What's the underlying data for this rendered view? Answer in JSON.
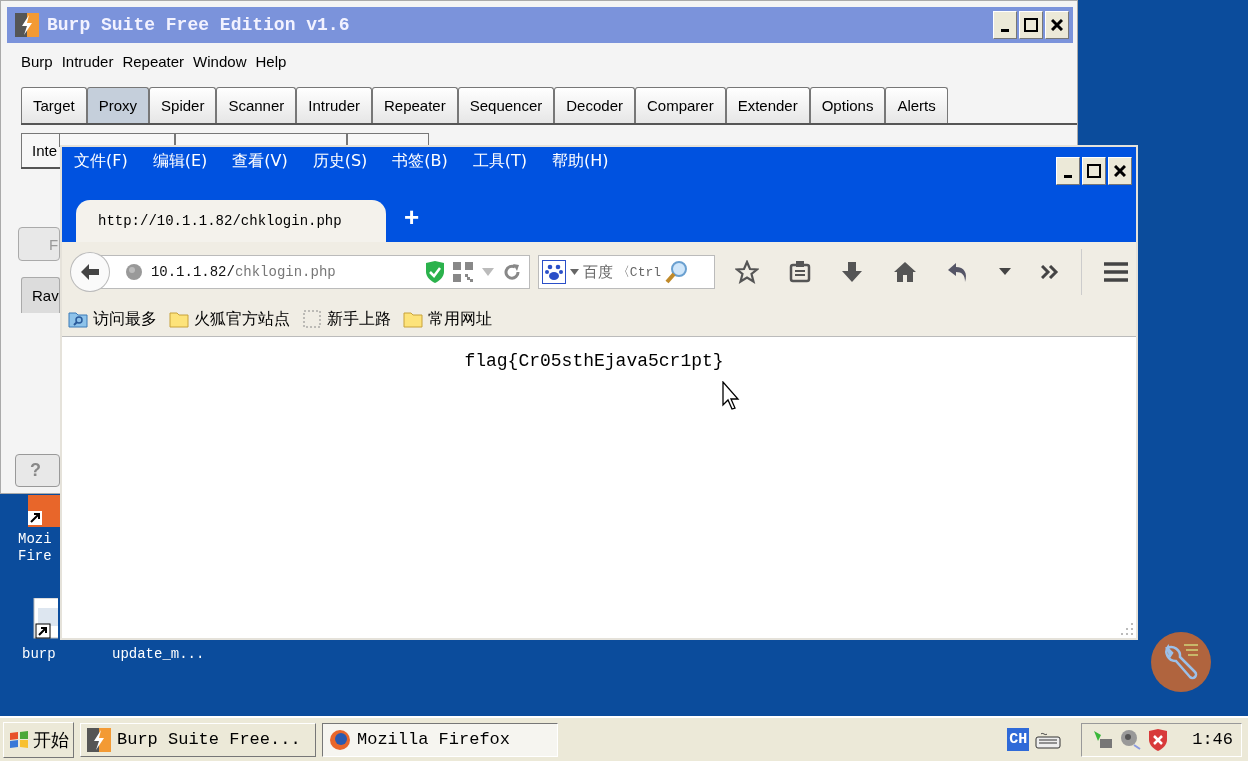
{
  "burp": {
    "title": "Burp Suite Free Edition v1.6",
    "menu": [
      "Burp",
      "Intruder",
      "Repeater",
      "Window",
      "Help"
    ],
    "tabs": [
      {
        "label": "Target",
        "selected": false
      },
      {
        "label": "Proxy",
        "selected": true
      },
      {
        "label": "Spider",
        "selected": false
      },
      {
        "label": "Scanner",
        "selected": false
      },
      {
        "label": "Intruder",
        "selected": false
      },
      {
        "label": "Repeater",
        "selected": false
      },
      {
        "label": "Sequencer",
        "selected": false
      },
      {
        "label": "Decoder",
        "selected": false
      },
      {
        "label": "Comparer",
        "selected": false
      },
      {
        "label": "Extender",
        "selected": false
      },
      {
        "label": "Options",
        "selected": false
      },
      {
        "label": "Alerts",
        "selected": false
      }
    ],
    "subtab": "Inte",
    "side_button": "F",
    "message_tab": "Rav",
    "help_button": "?"
  },
  "desktop_icons": [
    {
      "kind": "firefox",
      "lines": [
        "Mozi",
        "Fire"
      ]
    },
    {
      "kind": "shortcut",
      "lines": [
        "burp"
      ]
    },
    {
      "kind": "label-only",
      "lines": [
        "update_m..."
      ]
    }
  ],
  "firefox": {
    "menu": [
      "文件(F)",
      "编辑(E)",
      "查看(V)",
      "历史(S)",
      "书签(B)",
      "工具(T)",
      "帮助(H)"
    ],
    "tab_title": "http://10.1.1.82/chklogin.php",
    "new_tab": "+",
    "url_host": "10.1.1.82/",
    "url_path": "chklogin.php",
    "search_engine": "百度",
    "search_placeholder": "〈Ctrl",
    "bookmarks": [
      {
        "kind": "smart",
        "label": "访问最多"
      },
      {
        "kind": "folder",
        "label": "火狐官方站点"
      },
      {
        "kind": "page",
        "label": "新手上路"
      },
      {
        "kind": "folder",
        "label": "常用网址"
      }
    ],
    "content": "flag{Cr05sthEjava5cr1pt}"
  },
  "taskbar": {
    "start": "开始",
    "tasks": [
      {
        "kind": "burp",
        "label": "Burp Suite Free...",
        "selected": false
      },
      {
        "kind": "firefox",
        "label": "Mozilla Firefox",
        "selected": true
      }
    ],
    "ime": "CH",
    "clock": "1:46"
  }
}
